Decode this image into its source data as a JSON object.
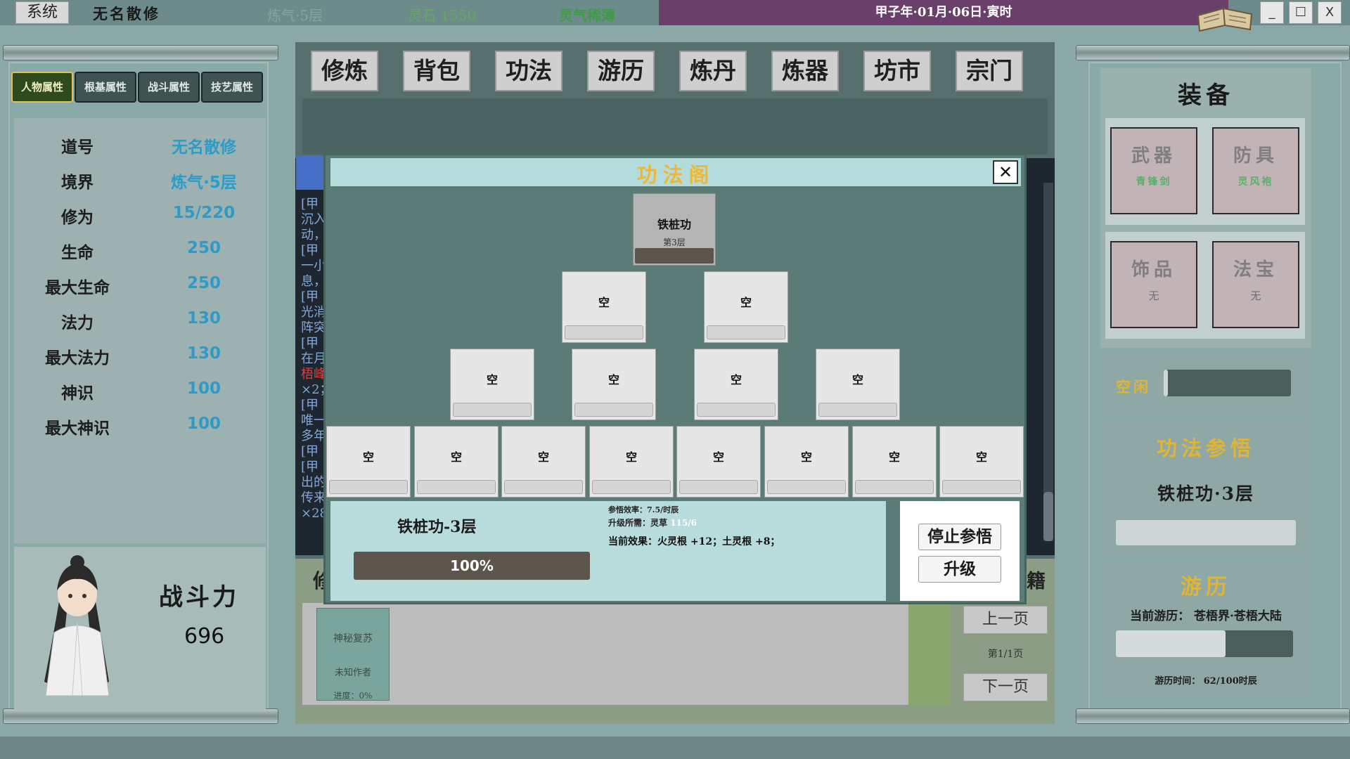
{
  "topbar": {
    "system_label": "系统",
    "player_name": "无名散修",
    "realm": "炼气·5层",
    "spirit_stone": "灵石 1550",
    "qi_status": "灵气稀薄",
    "date": "甲子年·01月·06日·寅时",
    "minimize": "_",
    "maximize": "☐",
    "close": "X"
  },
  "left": {
    "tabs": [
      "人物属性",
      "根基属性",
      "战斗属性",
      "技艺属性"
    ],
    "stats": [
      {
        "label": "道号",
        "value": "无名散修"
      },
      {
        "label": "境界",
        "value": "炼气·5层"
      },
      {
        "label": "修为",
        "value": "15/220"
      },
      {
        "label": "生命",
        "value": "250"
      },
      {
        "label": "最大生命",
        "value": "250"
      },
      {
        "label": "法力",
        "value": "130"
      },
      {
        "label": "最大法力",
        "value": "130"
      },
      {
        "label": "神识",
        "value": "100"
      },
      {
        "label": "最大神识",
        "value": "100"
      }
    ],
    "combat_label": "战斗力",
    "combat_value": "696"
  },
  "nav": [
    "修炼",
    "背包",
    "功法",
    "游历",
    "炼丹",
    "炼器",
    "坊市",
    "宗门"
  ],
  "log_fragments": [
    "[甲",
    "沉入",
    "动，",
    "[甲",
    "一小",
    "息，",
    "[甲",
    "光消",
    "阵突",
    "[甲",
    "在月",
    "梧峰",
    "×2；",
    "[甲",
    "唯一",
    "多年",
    "[甲",
    "[甲",
    "出的",
    "传来",
    "×28"
  ],
  "lower": {
    "cut_label": "修",
    "right_label": "籍",
    "book": {
      "title": "神秘复苏",
      "author": "未知作者",
      "progress": "进度：0%"
    },
    "prev_page": "上一页",
    "page_info": "第1/1页",
    "next_page": "下一页"
  },
  "right": {
    "equip_title": "装备",
    "slots": [
      {
        "name": "武器",
        "item": "青锋剑"
      },
      {
        "name": "防具",
        "item": "灵风袍"
      },
      {
        "name": "饰品",
        "item": "无"
      },
      {
        "name": "法宝",
        "item": "无"
      }
    ],
    "idle_label": "空闲",
    "idle_progress": 0.02,
    "cultivate_title": "功法参悟",
    "cultivate_current": "铁桩功·3层",
    "travel_title": "游历",
    "travel_current": "当前游历： 苍梧界·苍梧大陆",
    "travel_progress": 0.62,
    "travel_time": "游历时间： 62/100时辰"
  },
  "modal": {
    "title": "功法阁",
    "close": "✕",
    "top_skill": {
      "name": "铁桩功",
      "level": "第3层"
    },
    "empty_label": "空",
    "empty_count_rows": [
      2,
      4,
      8
    ],
    "detail": {
      "name": "铁桩功-3层",
      "progress_text": "100%",
      "efficiency": "参悟效率：7.5/时辰",
      "requirement_prefix": "升级所需：灵草 ",
      "requirement_value": "115/6",
      "current_effect": "当前效果：火灵根 +12；土灵根 +8；"
    },
    "stop_button": "停止参悟",
    "upgrade_button": "升级"
  },
  "colors": {
    "accent_gold": "#e0b535",
    "stat_blue": "#2d9bc9",
    "date_bar": "#6a3f6a"
  }
}
